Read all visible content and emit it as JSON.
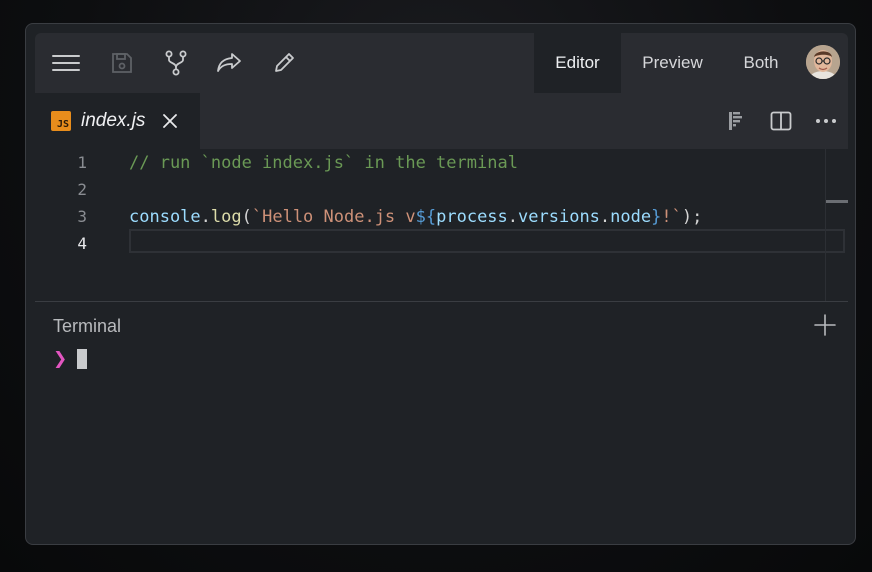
{
  "toolbar": {
    "icons": [
      "menu-icon",
      "save-icon",
      "fork-icon",
      "share-icon",
      "edit-icon"
    ],
    "modes": [
      {
        "label": "Editor",
        "active": true
      },
      {
        "label": "Preview",
        "active": false
      },
      {
        "label": "Both",
        "active": false
      }
    ]
  },
  "file_tab": {
    "badge": "JS",
    "name": "index.js"
  },
  "editor": {
    "lines": [
      {
        "number": "1",
        "text": "// run `node index.js` in the terminal"
      },
      {
        "number": "2",
        "text": ""
      },
      {
        "number": "3",
        "text": "console.log(`Hello Node.js v${process.versions.node}!`);"
      },
      {
        "number": "4",
        "text": ""
      }
    ],
    "active_line": 4,
    "code_parts": {
      "comment": "// run `node index.js` in the terminal",
      "l3_console": "console",
      "l3_dot1": ".",
      "l3_log": "log",
      "l3_open": "(",
      "l3_str1": "`Hello Node.js v",
      "l3_tpl_open": "${",
      "l3_process": "process",
      "l3_dot2": ".",
      "l3_versions": "versions",
      "l3_dot3": ".",
      "l3_node": "node",
      "l3_tpl_close": "}",
      "l3_str2": "!`",
      "l3_close": ");"
    }
  },
  "terminal": {
    "title": "Terminal",
    "prompt": "❯"
  },
  "colors": {
    "background": "#1f2226",
    "toolbar": "#2a2c31",
    "js_badge": "#e88d1c",
    "prompt": "#e255c0"
  }
}
